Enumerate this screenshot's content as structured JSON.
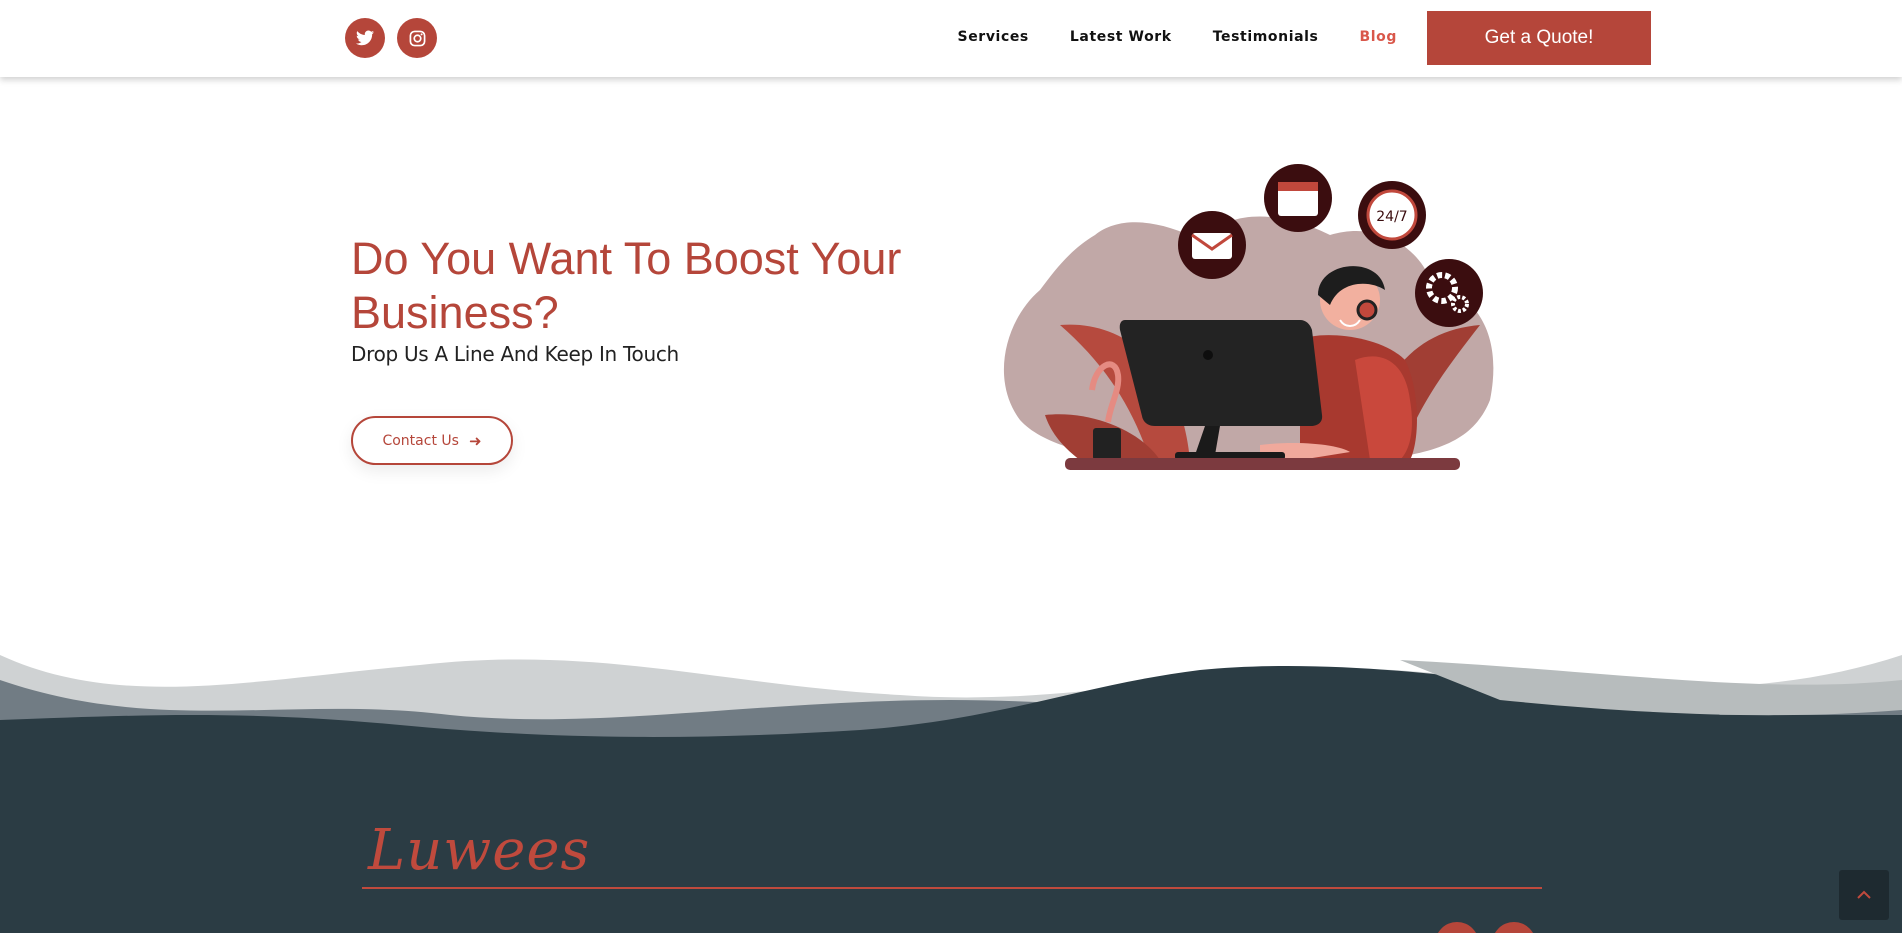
{
  "header": {
    "social": [
      {
        "name": "twitter-icon"
      },
      {
        "name": "instagram-icon"
      }
    ],
    "nav": [
      {
        "label": "Services",
        "active": false
      },
      {
        "label": "Latest Work",
        "active": false
      },
      {
        "label": "Testimonials",
        "active": false
      },
      {
        "label": "Blog",
        "active": true
      }
    ],
    "quote_button": "Get a Quote!"
  },
  "hero": {
    "title": "Do You Want To Boost Your Business?",
    "subtitle": "Drop Us A Line And Keep In Touch",
    "contact_button": "Contact Us",
    "illustration_badge": "24/7"
  },
  "footer": {
    "logo": "Luwees"
  },
  "colors": {
    "accent": "#b5463a",
    "active_nav": "#d9574a",
    "footer_bg": "#2b3c44",
    "wave_light": "#cfd2d3",
    "wave_mid": "#717c84"
  }
}
